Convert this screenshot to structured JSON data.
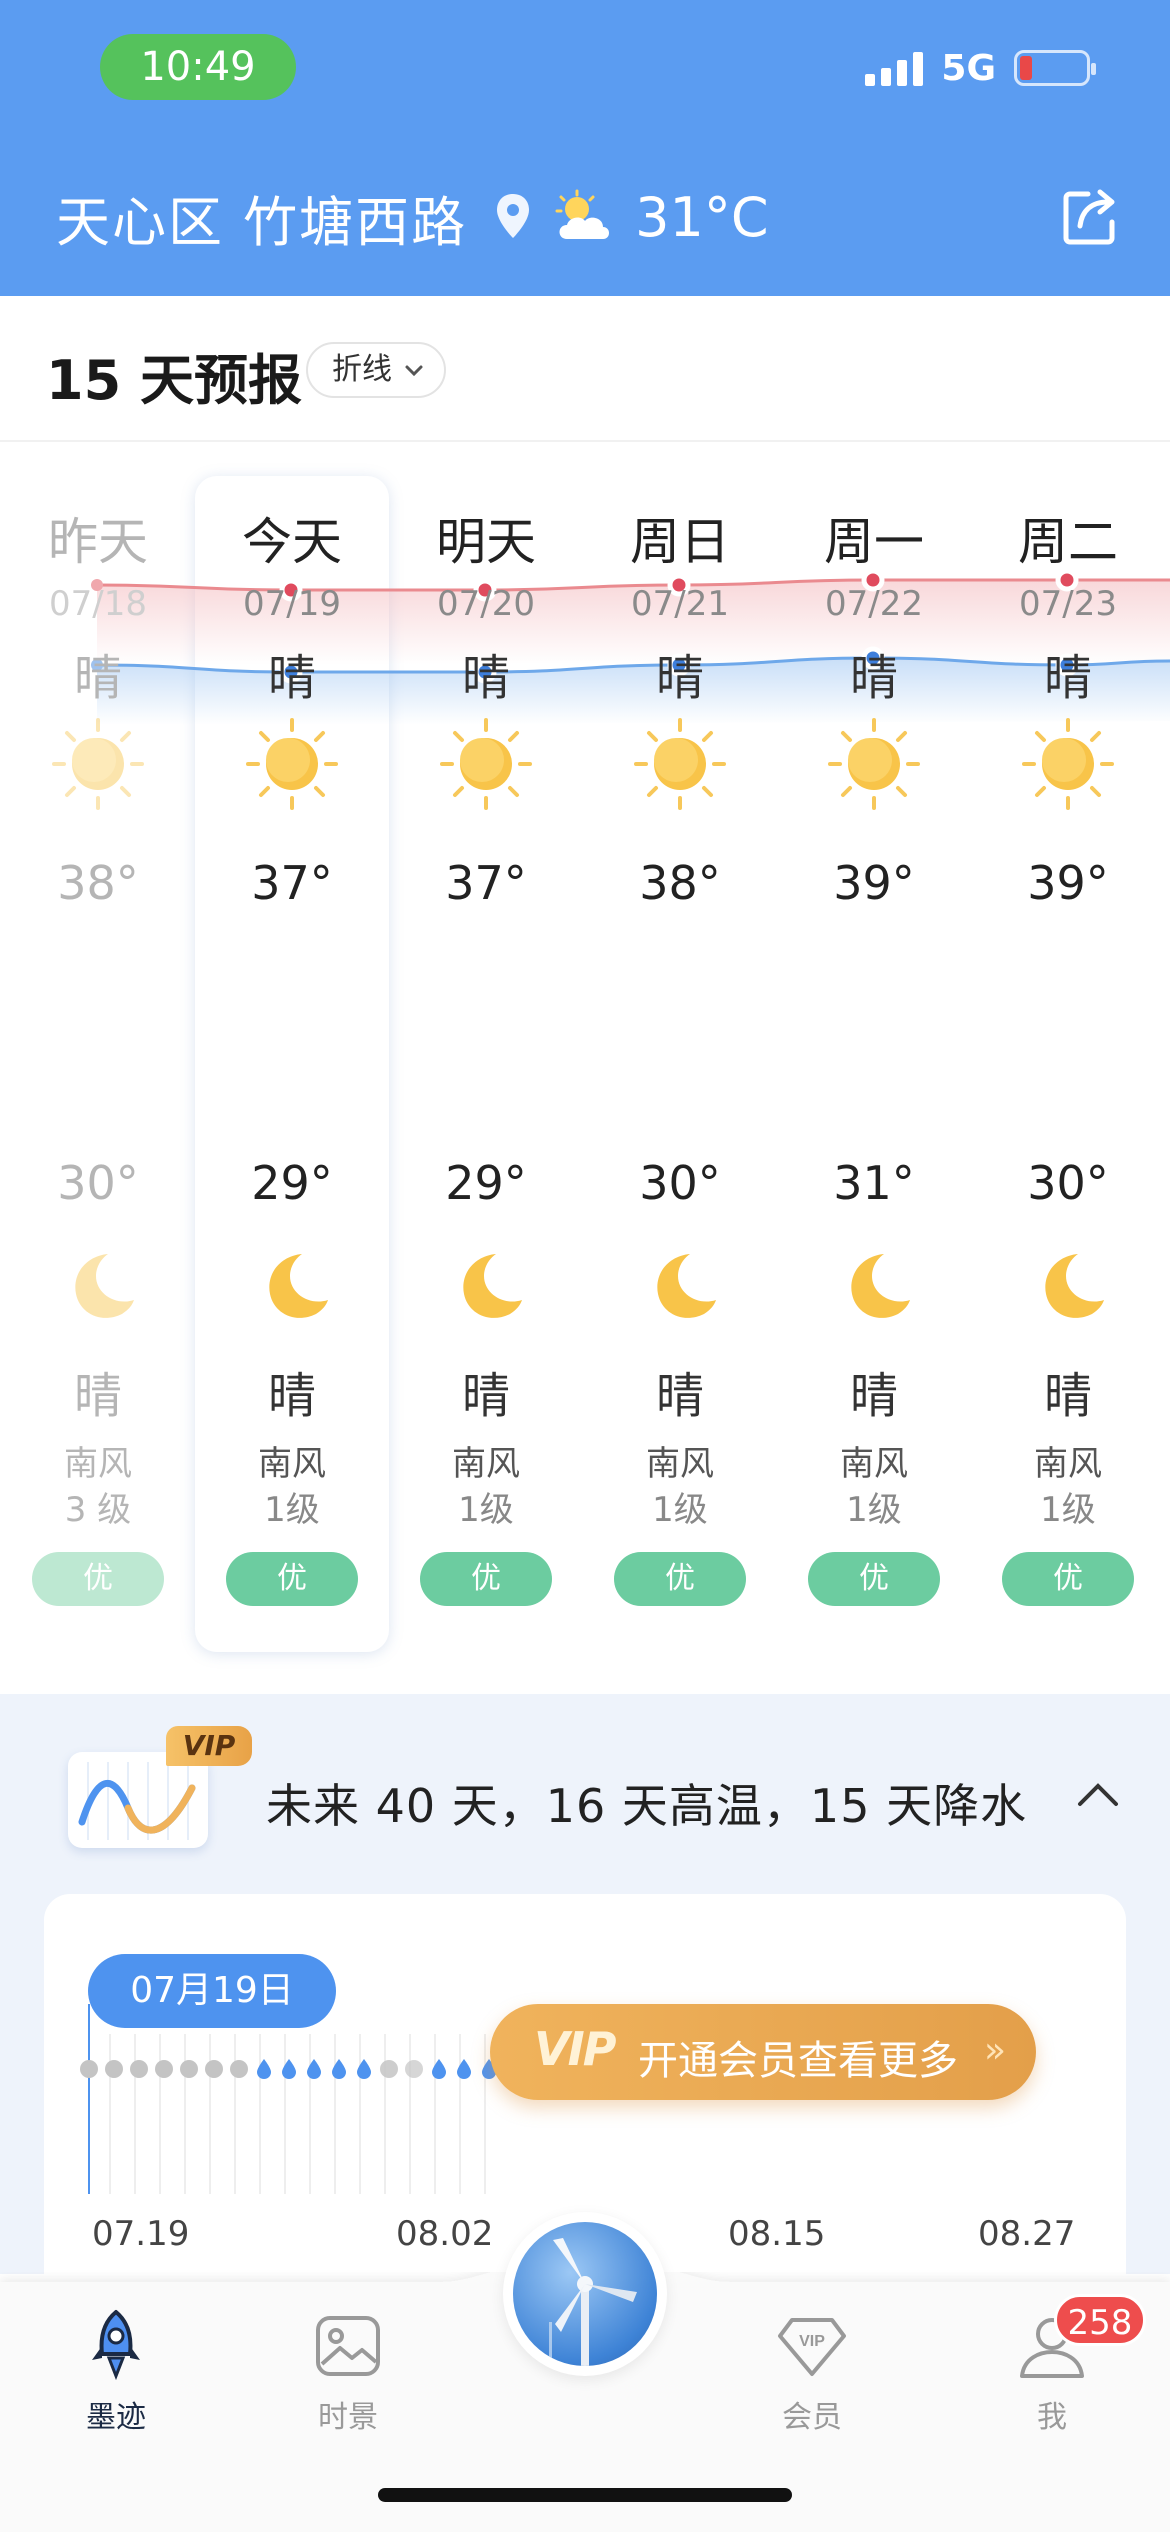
{
  "status": {
    "time": "10:49",
    "network": "5G"
  },
  "header": {
    "location": "天心区 竹塘西路",
    "temp_now": "31°C"
  },
  "forecast": {
    "title": "15 天预报",
    "view_mode": "折线",
    "days": [
      {
        "name": "昨天",
        "date": "07/18",
        "day_weather": "晴",
        "high": "38°",
        "low": "30°",
        "night_weather": "晴",
        "wind": "南风",
        "wind_level": "3 级",
        "aqi": "优",
        "past": true
      },
      {
        "name": "今天",
        "date": "07/19",
        "day_weather": "晴",
        "high": "37°",
        "low": "29°",
        "night_weather": "晴",
        "wind": "南风",
        "wind_level": "1级",
        "aqi": "优",
        "past": false
      },
      {
        "name": "明天",
        "date": "07/20",
        "day_weather": "晴",
        "high": "37°",
        "low": "29°",
        "night_weather": "晴",
        "wind": "南风",
        "wind_level": "1级",
        "aqi": "优",
        "past": false
      },
      {
        "name": "周日",
        "date": "07/21",
        "day_weather": "晴",
        "high": "38°",
        "low": "30°",
        "night_weather": "晴",
        "wind": "南风",
        "wind_level": "1级",
        "aqi": "优",
        "past": false
      },
      {
        "name": "周一",
        "date": "07/22",
        "day_weather": "晴",
        "high": "39°",
        "low": "31°",
        "night_weather": "晴",
        "wind": "南风",
        "wind_level": "1级",
        "aqi": "优",
        "past": false
      },
      {
        "name": "周二",
        "date": "07/23",
        "day_weather": "晴",
        "high": "39°",
        "low": "30°",
        "night_weather": "晴",
        "wind": "南风",
        "wind_level": "1级",
        "aqi": "优",
        "past": false
      }
    ],
    "high_values": [
      38,
      37,
      37,
      38,
      39,
      39
    ],
    "low_values": [
      30,
      29,
      29,
      30,
      31,
      30
    ],
    "colors": {
      "high_line": "#ea8a8f",
      "low_line": "#6ea8ea",
      "aqi_good": "#6ccca0"
    }
  },
  "long_range": {
    "vip_tag": "VIP",
    "summary": "未来 40 天，16 天高温，15 天降水",
    "selected_date": "07月19日",
    "cta_vip": "VIP",
    "cta_text": "开通会员查看更多",
    "cta_arrow": "»",
    "x_labels": [
      "07.19",
      "08.02",
      "08.15",
      "08.27"
    ],
    "rain_pattern": [
      0,
      0,
      0,
      0,
      0,
      0,
      0,
      1,
      1,
      1,
      1,
      1,
      0,
      0,
      1,
      1,
      1
    ]
  },
  "nav": {
    "items": [
      {
        "label": "墨迹",
        "icon": "rocket-icon",
        "active": true
      },
      {
        "label": "时景",
        "icon": "photo-icon",
        "active": false
      },
      {
        "label": "会员",
        "icon": "vip-diamond-icon",
        "active": false
      },
      {
        "label": "我",
        "icon": "user-icon",
        "active": false
      }
    ],
    "badge": "258"
  }
}
